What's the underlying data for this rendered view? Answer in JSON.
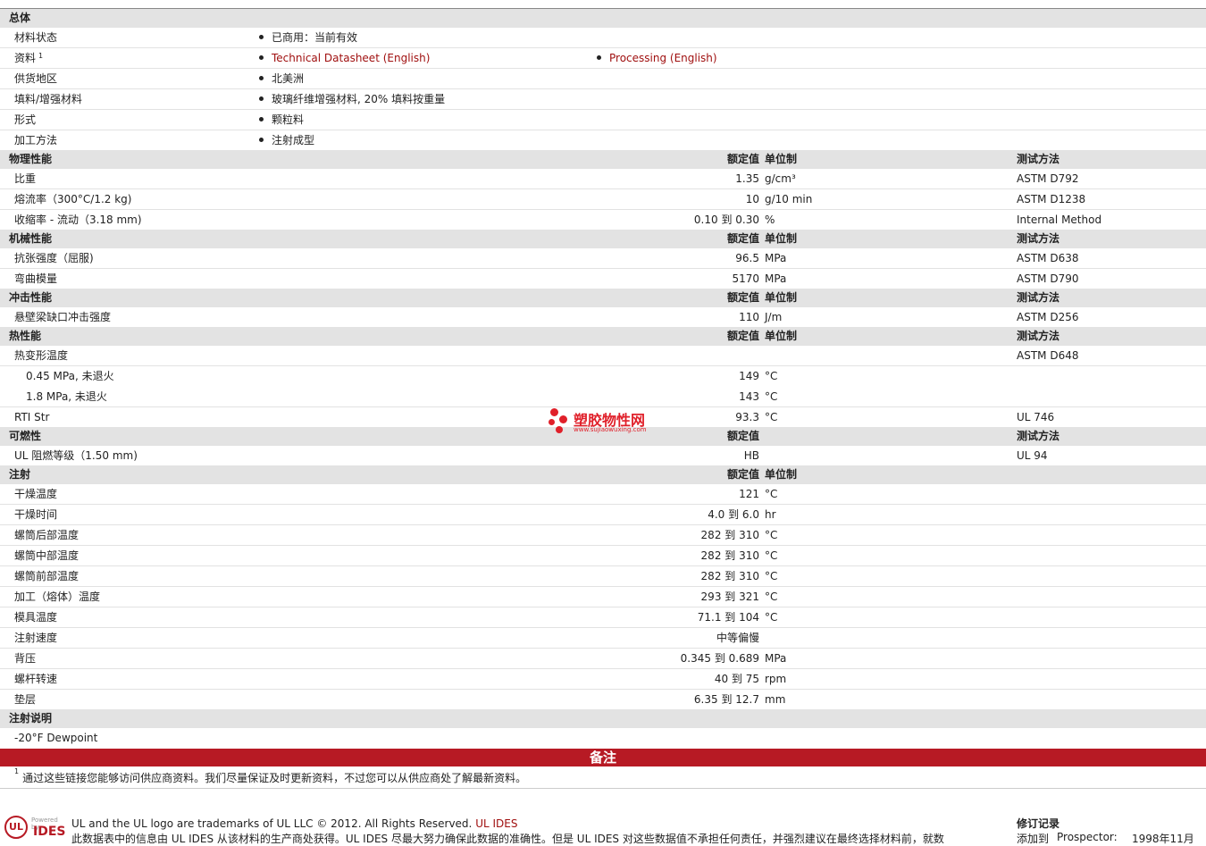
{
  "general": {
    "title": "总体",
    "rows": [
      {
        "label": "材料状态",
        "items": [
          "已商用：当前有效"
        ]
      },
      {
        "label": "资料",
        "sup": "1",
        "items": [
          "Technical Datasheet (English)",
          "Processing (English)"
        ]
      },
      {
        "label": "供货地区",
        "items": [
          "北美洲"
        ]
      },
      {
        "label": "填料/增强材料",
        "items": [
          "玻璃纤维增强材料, 20% 填料按重量"
        ]
      },
      {
        "label": "形式",
        "items": [
          "颗粒料"
        ]
      },
      {
        "label": "加工方法",
        "items": [
          "注射成型"
        ]
      }
    ]
  },
  "headers": {
    "nominal": "额定值",
    "unit": "单位制",
    "method": "测试方法"
  },
  "physical": {
    "title": "物理性能",
    "rows": [
      {
        "label": "比重",
        "value": "1.35",
        "unit": "g/cm³",
        "method": "ASTM D792"
      },
      {
        "label": "熔流率（300°C/1.2 kg)",
        "value": "10",
        "unit": "g/10 min",
        "method": "ASTM D1238"
      },
      {
        "label": "收缩率 - 流动（3.18 mm)",
        "value": "0.10 到  0.30",
        "unit": "%",
        "method": "Internal Method"
      }
    ]
  },
  "mechanical": {
    "title": "机械性能",
    "rows": [
      {
        "label": "抗张强度（屈服)",
        "value": "96.5",
        "unit": "MPa",
        "method": "ASTM D638"
      },
      {
        "label": "弯曲模量",
        "value": "5170",
        "unit": "MPa",
        "method": "ASTM D790"
      }
    ]
  },
  "impact": {
    "title": "冲击性能",
    "rows": [
      {
        "label": "悬壁梁缺口冲击强度",
        "value": "110",
        "unit": "J/m",
        "method": "ASTM D256"
      }
    ]
  },
  "thermal": {
    "title": "热性能",
    "rows": [
      {
        "label": "热变形温度",
        "value": "",
        "unit": "",
        "method": "ASTM D648"
      },
      {
        "label": "0.45 MPa, 未退火",
        "value": "149",
        "unit": "°C",
        "method": ""
      },
      {
        "label": "1.8 MPa, 未退火",
        "value": "143",
        "unit": "°C",
        "method": ""
      },
      {
        "label": "RTI Str",
        "value": "93.3",
        "unit": "°C",
        "method": "UL 746"
      }
    ]
  },
  "flammability": {
    "title": "可燃性",
    "rows": [
      {
        "label": "UL 阻燃等级（1.50 mm)",
        "value": "HB",
        "unit": "",
        "method": "UL 94"
      }
    ]
  },
  "injection": {
    "title": "注射",
    "rows": [
      {
        "label": "干燥温度",
        "value": "121",
        "unit": "°C"
      },
      {
        "label": "干燥时间",
        "value": "4.0 到  6.0",
        "unit": "hr"
      },
      {
        "label": "螺筒后部温度",
        "value": "282 到  310",
        "unit": "°C"
      },
      {
        "label": "螺筒中部温度",
        "value": "282 到  310",
        "unit": "°C"
      },
      {
        "label": "螺筒前部温度",
        "value": "282 到  310",
        "unit": "°C"
      },
      {
        "label": "加工（熔体）温度",
        "value": "293 到  321",
        "unit": "°C"
      },
      {
        "label": "模具温度",
        "value": "71.1 到  104",
        "unit": "°C"
      },
      {
        "label": "注射速度",
        "value": "中等偏慢",
        "unit": ""
      },
      {
        "label": "背压",
        "value": "0.345 到  0.689",
        "unit": "MPa"
      },
      {
        "label": "螺杆转速",
        "value": "40 到  75",
        "unit": "rpm"
      },
      {
        "label": "垫层",
        "value": "6.35 到  12.7",
        "unit": "mm"
      }
    ]
  },
  "injection_notes": {
    "title": "注射说明",
    "text": "-20°F Dewpoint"
  },
  "notes": {
    "banner": "备注",
    "footnote_num": "1",
    "footnote": "通过这些链接您能够访问供应商资料。我们尽量保证及时更新资料，不过您可以从供应商处了解最新资料。"
  },
  "footer": {
    "poweredby": "Powered by",
    "logo_ul": "UL",
    "logo_ides": "IDES",
    "trademark": "UL and the UL logo are trademarks of UL LLC © 2012. All Rights Reserved.",
    "trademark_link": "UL IDES",
    "disclaimer": "此数据表中的信息由  UL IDES 从该材料的生产商处获得。UL IDES 尽最大努力确保此数据的准确性。但是  UL IDES 对这些数据值不承担任何责任，并强烈建议在最终选择材料前，就数",
    "revision_title": "修订记录",
    "revision_label": "添加到",
    "revision_value": "Prospector:",
    "revision_date": "1998年11月"
  },
  "watermark": {
    "title": "塑胶物性网",
    "url": "www.sujiaowuxing.com"
  },
  "colors": {
    "banner": "#b71a24",
    "link": "#a01010",
    "section_bg": "#e3e3e3"
  }
}
